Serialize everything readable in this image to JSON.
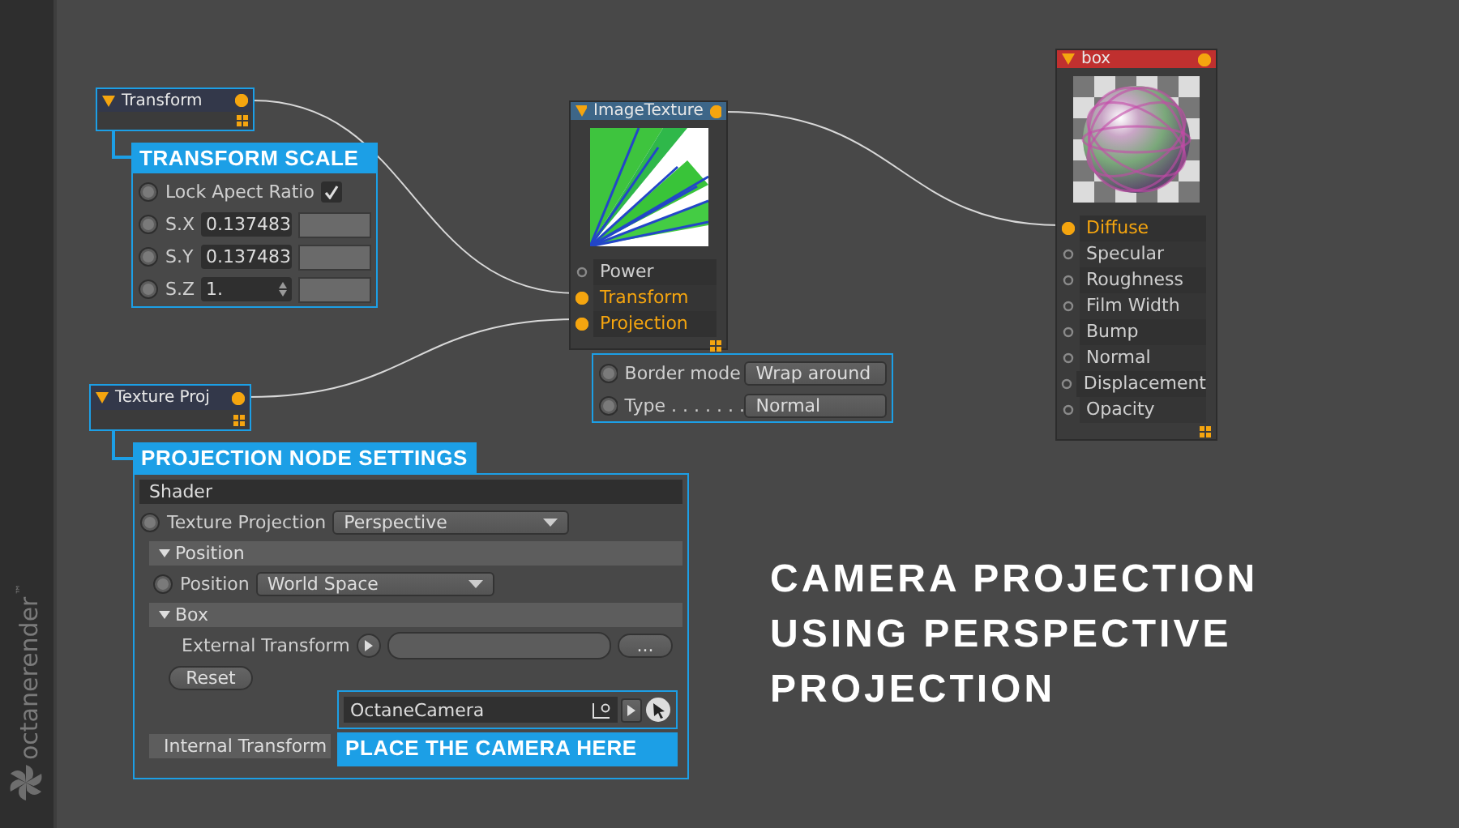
{
  "brand": {
    "name": "octanerender",
    "mark": "™"
  },
  "nodes": [
    {
      "title": "Transform",
      "color": "#33384a",
      "highlighted": true,
      "kind": "plain"
    },
    {
      "title": "ImageTexture",
      "color": "#3d6688",
      "highlighted": false,
      "kind": "texture",
      "ports": [
        {
          "label": "Power",
          "connected": false
        },
        {
          "label": "Transform",
          "connected": true
        },
        {
          "label": "Projection",
          "connected": true
        }
      ]
    },
    {
      "title": "box",
      "color": "#c0302f",
      "highlighted": false,
      "kind": "material",
      "ports": [
        {
          "label": "Diffuse",
          "connected": true
        },
        {
          "label": "Specular",
          "connected": false
        },
        {
          "label": "Roughness",
          "connected": false
        },
        {
          "label": "Film Width",
          "connected": false
        },
        {
          "label": "Bump",
          "connected": false
        },
        {
          "label": "Normal",
          "connected": false
        },
        {
          "label": "Displacement",
          "connected": false
        },
        {
          "label": "Opacity",
          "connected": false
        }
      ]
    },
    {
      "title": "Texture Proj",
      "color": "#33384a",
      "highlighted": true,
      "kind": "plain"
    }
  ],
  "transform_scale": {
    "title": "TRANSFORM SCALE",
    "lock_label": "Lock Apect Ratio",
    "lock_checked": true,
    "rows": [
      {
        "label": "S.X",
        "value": "0.137483"
      },
      {
        "label": "S.Y",
        "value": "0.137483"
      },
      {
        "label": "S.Z",
        "value": "1."
      }
    ]
  },
  "texture_settings": [
    {
      "label": "Border mode",
      "value": "Wrap around"
    },
    {
      "label": "Type . . . . . . .",
      "value": "Normal"
    }
  ],
  "projection_settings": {
    "title": "PROJECTION NODE SETTINGS",
    "shader": "Shader",
    "texture_projection_label": "Texture Projection",
    "texture_projection_value": "Perspective",
    "position_section": "Position",
    "position_label": "Position",
    "position_value": "World Space",
    "box_section": "Box",
    "external_transform_label": "External Transform",
    "browse_button": "...",
    "reset_button": "Reset",
    "internal_transform": "Internal Transform",
    "camera_value": "OctaneCamera",
    "camera_callout": "PLACE THE CAMERA HERE"
  },
  "headline": [
    "CAMERA PROJECTION",
    "USING PERSPECTIVE",
    "PROJECTION"
  ]
}
